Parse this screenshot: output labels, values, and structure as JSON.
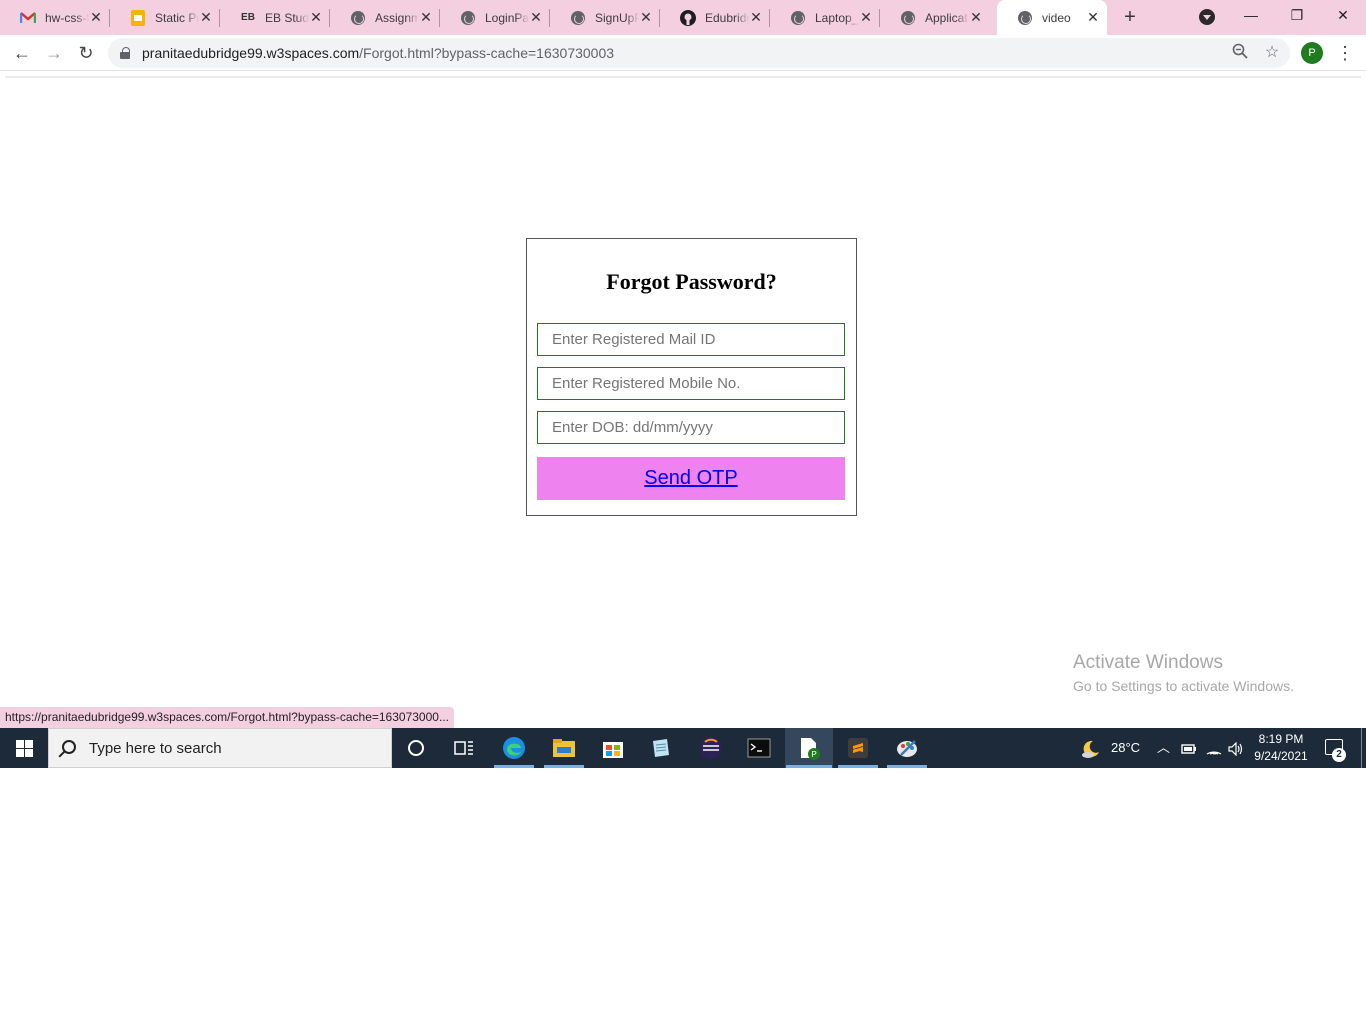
{
  "browser": {
    "tabs": [
      {
        "label": "hw-css-f",
        "icon": "gmail-icon",
        "active": false
      },
      {
        "label": "Static Pr",
        "icon": "slides-icon",
        "active": false
      },
      {
        "label": "EB Stude",
        "icon": "eb-icon",
        "active": false
      },
      {
        "label": "Assignm",
        "icon": "globe-icon",
        "active": false
      },
      {
        "label": "LoginPag",
        "icon": "globe-icon",
        "active": false
      },
      {
        "label": "SignUpP",
        "icon": "globe-icon",
        "active": false
      },
      {
        "label": "Edubridg",
        "icon": "github-icon",
        "active": false
      },
      {
        "label": "Laptop_V",
        "icon": "globe-icon",
        "active": false
      },
      {
        "label": "Applicati",
        "icon": "globe-icon",
        "active": false
      },
      {
        "label": "video",
        "icon": "globe-icon",
        "active": true
      }
    ],
    "url_host": "pranitaedubridge99.w3spaces.com",
    "url_path": "/Forgot.html?bypass-cache=1630730003",
    "profile_initial": "P",
    "status_url": "https://pranitaedubridge99.w3spaces.com/Forgot.html?bypass-cache=163073000..."
  },
  "form": {
    "title": "Forgot Password?",
    "mail_placeholder": "Enter Registered Mail ID",
    "mobile_placeholder": "Enter Registered Mobile No.",
    "dob_placeholder": "Enter DOB: dd/mm/yyyy",
    "submit_label": "Send OTP",
    "button_color": "#ee82ee",
    "field_border_color": "#1e7b1e"
  },
  "watermark": {
    "line1": "Activate Windows",
    "line2": "Go to Settings to activate Windows."
  },
  "taskbar": {
    "search_placeholder": "Type here to search",
    "temperature": "28°C",
    "time": "8:19 PM",
    "date": "9/24/2021",
    "notification_count": "2"
  }
}
